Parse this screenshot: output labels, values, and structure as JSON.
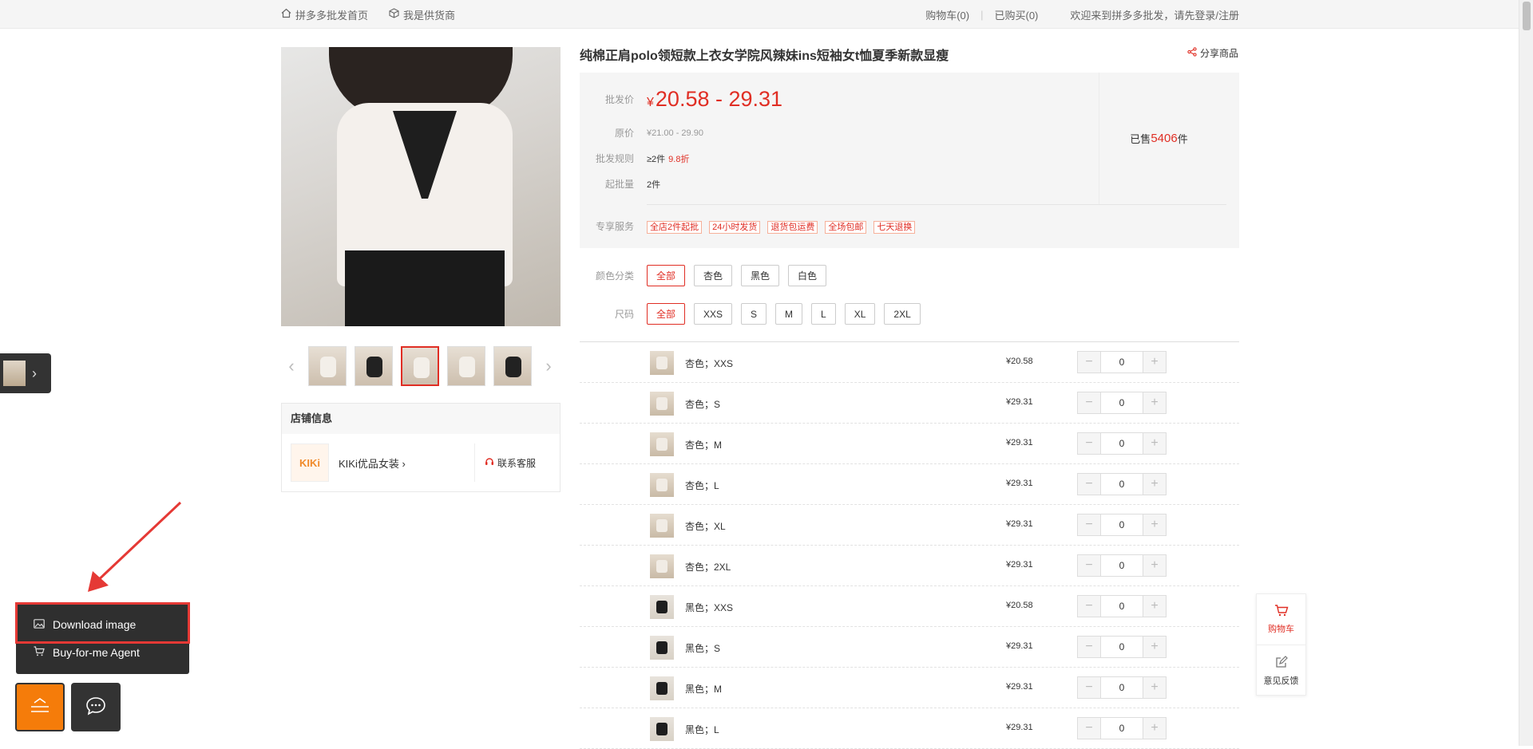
{
  "topbar": {
    "home_link": "拼多多批发首页",
    "supplier_link": "我是供货商",
    "cart_link": "购物车(0)",
    "bought_link": "已购买(0)",
    "welcome": "欢迎来到拼多多批发，请先登录/注册"
  },
  "product": {
    "title": "纯棉正肩polo领短款上衣女学院风辣妹ins短袖女t恤夏季新款显瘦",
    "share_label": "分享商品",
    "currency_symbol": "¥",
    "wholesale_label": "批发价",
    "wholesale_price": "20.58 - 29.31",
    "original_label": "原价",
    "original_price": "¥21.00 - 29.90",
    "rule_label": "批发规则",
    "rule_text": "≥2件",
    "rule_discount": "9.8折",
    "min_label": "起批量",
    "min_value": "2件",
    "sold_prefix": "已售",
    "sold_count": "5406",
    "sold_suffix": "件",
    "service_label": "专享服务",
    "services": [
      "全店2件起批",
      "24小时发货",
      "退货包运费",
      "全场包邮",
      "七天退换"
    ]
  },
  "options": {
    "color_label": "颜色分类",
    "colors": [
      "全部",
      "杏色",
      "黑色",
      "白色"
    ],
    "size_label": "尺码",
    "sizes": [
      "全部",
      "XXS",
      "S",
      "M",
      "L",
      "XL",
      "2XL"
    ]
  },
  "skus": [
    {
      "name": "杏色；XXS",
      "price": "¥20.58",
      "qty": "0",
      "tone": "light"
    },
    {
      "name": "杏色；S",
      "price": "¥29.31",
      "qty": "0",
      "tone": "light"
    },
    {
      "name": "杏色；M",
      "price": "¥29.31",
      "qty": "0",
      "tone": "light"
    },
    {
      "name": "杏色；L",
      "price": "¥29.31",
      "qty": "0",
      "tone": "light"
    },
    {
      "name": "杏色；XL",
      "price": "¥29.31",
      "qty": "0",
      "tone": "light"
    },
    {
      "name": "杏色；2XL",
      "price": "¥29.31",
      "qty": "0",
      "tone": "light"
    },
    {
      "name": "黑色；XXS",
      "price": "¥20.58",
      "qty": "0",
      "tone": "dark"
    },
    {
      "name": "黑色；S",
      "price": "¥29.31",
      "qty": "0",
      "tone": "dark"
    },
    {
      "name": "黑色；M",
      "price": "¥29.31",
      "qty": "0",
      "tone": "dark"
    },
    {
      "name": "黑色；L",
      "price": "¥29.31",
      "qty": "0",
      "tone": "dark"
    }
  ],
  "shop": {
    "header": "店铺信息",
    "logo_text": "KIKi",
    "name": "KIKi优品女装",
    "contact": "联系客服"
  },
  "float_widget": {
    "cart": "购物车",
    "feedback": "意见反馈"
  },
  "extension": {
    "download_image": "Download image",
    "agent": "Buy-for-me Agent"
  },
  "colors": {
    "accent": "#e02e24",
    "extension_bg": "#2f2f2f",
    "fab_orange": "#f57c0a",
    "highlight": "#e53935"
  }
}
